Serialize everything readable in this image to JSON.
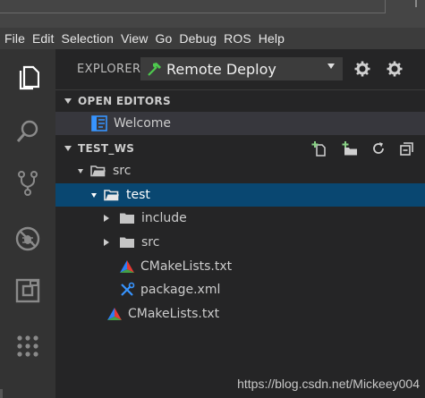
{
  "menu": [
    "File",
    "Edit",
    "Selection",
    "View",
    "Go",
    "Debug",
    "ROS",
    "Help"
  ],
  "activity_bar": [
    {
      "name": "files-icon",
      "active": true
    },
    {
      "name": "search-icon",
      "active": false
    },
    {
      "name": "source-control-icon",
      "active": false
    },
    {
      "name": "debug-icon",
      "active": false
    },
    {
      "name": "extensions-icon",
      "active": false
    },
    {
      "name": "ros-grid-icon",
      "active": false
    }
  ],
  "explorer": {
    "title": "EXPLORER",
    "deploy_select": {
      "value": "Remote Deploy",
      "icon": "hammer-icon"
    },
    "header_icons": [
      "gear-icon",
      "settings-gear-icon"
    ]
  },
  "open_editors": {
    "label": "OPEN EDITORS",
    "items": [
      {
        "label": "Welcome",
        "icon": "welcome-icon"
      }
    ]
  },
  "workspace": {
    "label": "TEST_WS",
    "actions": [
      "new-file-icon",
      "new-folder-icon",
      "refresh-icon",
      "collapse-all-icon"
    ],
    "tree": {
      "root_src": "src",
      "test": "test",
      "include": "include",
      "inner_src": "src",
      "cmakelists_inner": "CMakeLists.txt",
      "package_xml": "package.xml",
      "cmakelists_outer": "CMakeLists.txt"
    }
  },
  "watermark": "https://blog.csdn.net/Mickeey004",
  "colors": {
    "activity_bar": "#333333",
    "sidebar": "#252526",
    "selection": "#094771",
    "menubar": "#3c3c3c",
    "hammer": "#4ec94e",
    "package_icon": "#3794ff"
  }
}
